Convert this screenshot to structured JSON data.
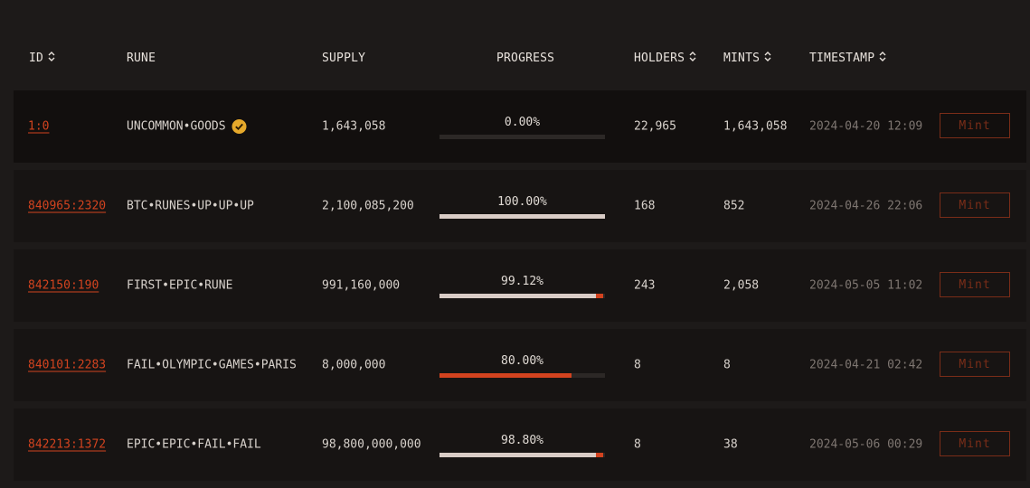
{
  "header": {
    "id": "ID",
    "rune": "RUNE",
    "supply": "SUPPLY",
    "progress": "PROGRESS",
    "holders": "HOLDERS",
    "mints": "MINTS",
    "timestamp": "TIMESTAMP"
  },
  "colors": {
    "accent": "#d2431f",
    "fill_light": "#d9ccc6",
    "verified": "#e6a92b"
  },
  "rows": [
    {
      "id": "1:0",
      "rune": "UNCOMMON•GOODS",
      "verified": true,
      "supply": "1,643,058",
      "progress_label": "0.00%",
      "progress": 0,
      "holders": "22,965",
      "mints": "1,643,058",
      "timestamp": "2024-04-20 12:09",
      "action": "Mint"
    },
    {
      "id": "840965:2320",
      "rune": "BTC•RUNES•UP•UP•UP",
      "verified": false,
      "supply": "2,100,085,200",
      "progress_label": "100.00%",
      "progress": 100,
      "holders": "168",
      "mints": "852",
      "timestamp": "2024-04-26 22:06",
      "action": "Mint"
    },
    {
      "id": "842150:190",
      "rune": "FIRST•EPIC•RUNE",
      "verified": false,
      "supply": "991,160,000",
      "progress_label": "99.12%",
      "progress": 99.12,
      "holders": "243",
      "mints": "2,058",
      "timestamp": "2024-05-05 11:02",
      "action": "Mint"
    },
    {
      "id": "840101:2283",
      "rune": "FAIL•OLYMPIC•GAMES•PARIS",
      "verified": false,
      "supply": "8,000,000",
      "progress_label": "80.00%",
      "progress": 80,
      "holders": "8",
      "mints": "8",
      "timestamp": "2024-04-21 02:42",
      "action": "Mint"
    },
    {
      "id": "842213:1372",
      "rune": "EPIC•EPIC•FAIL•FAIL",
      "verified": false,
      "supply": "98,800,000,000",
      "progress_label": "98.80%",
      "progress": 98.8,
      "holders": "8",
      "mints": "38",
      "timestamp": "2024-05-06 00:29",
      "action": "Mint"
    }
  ]
}
